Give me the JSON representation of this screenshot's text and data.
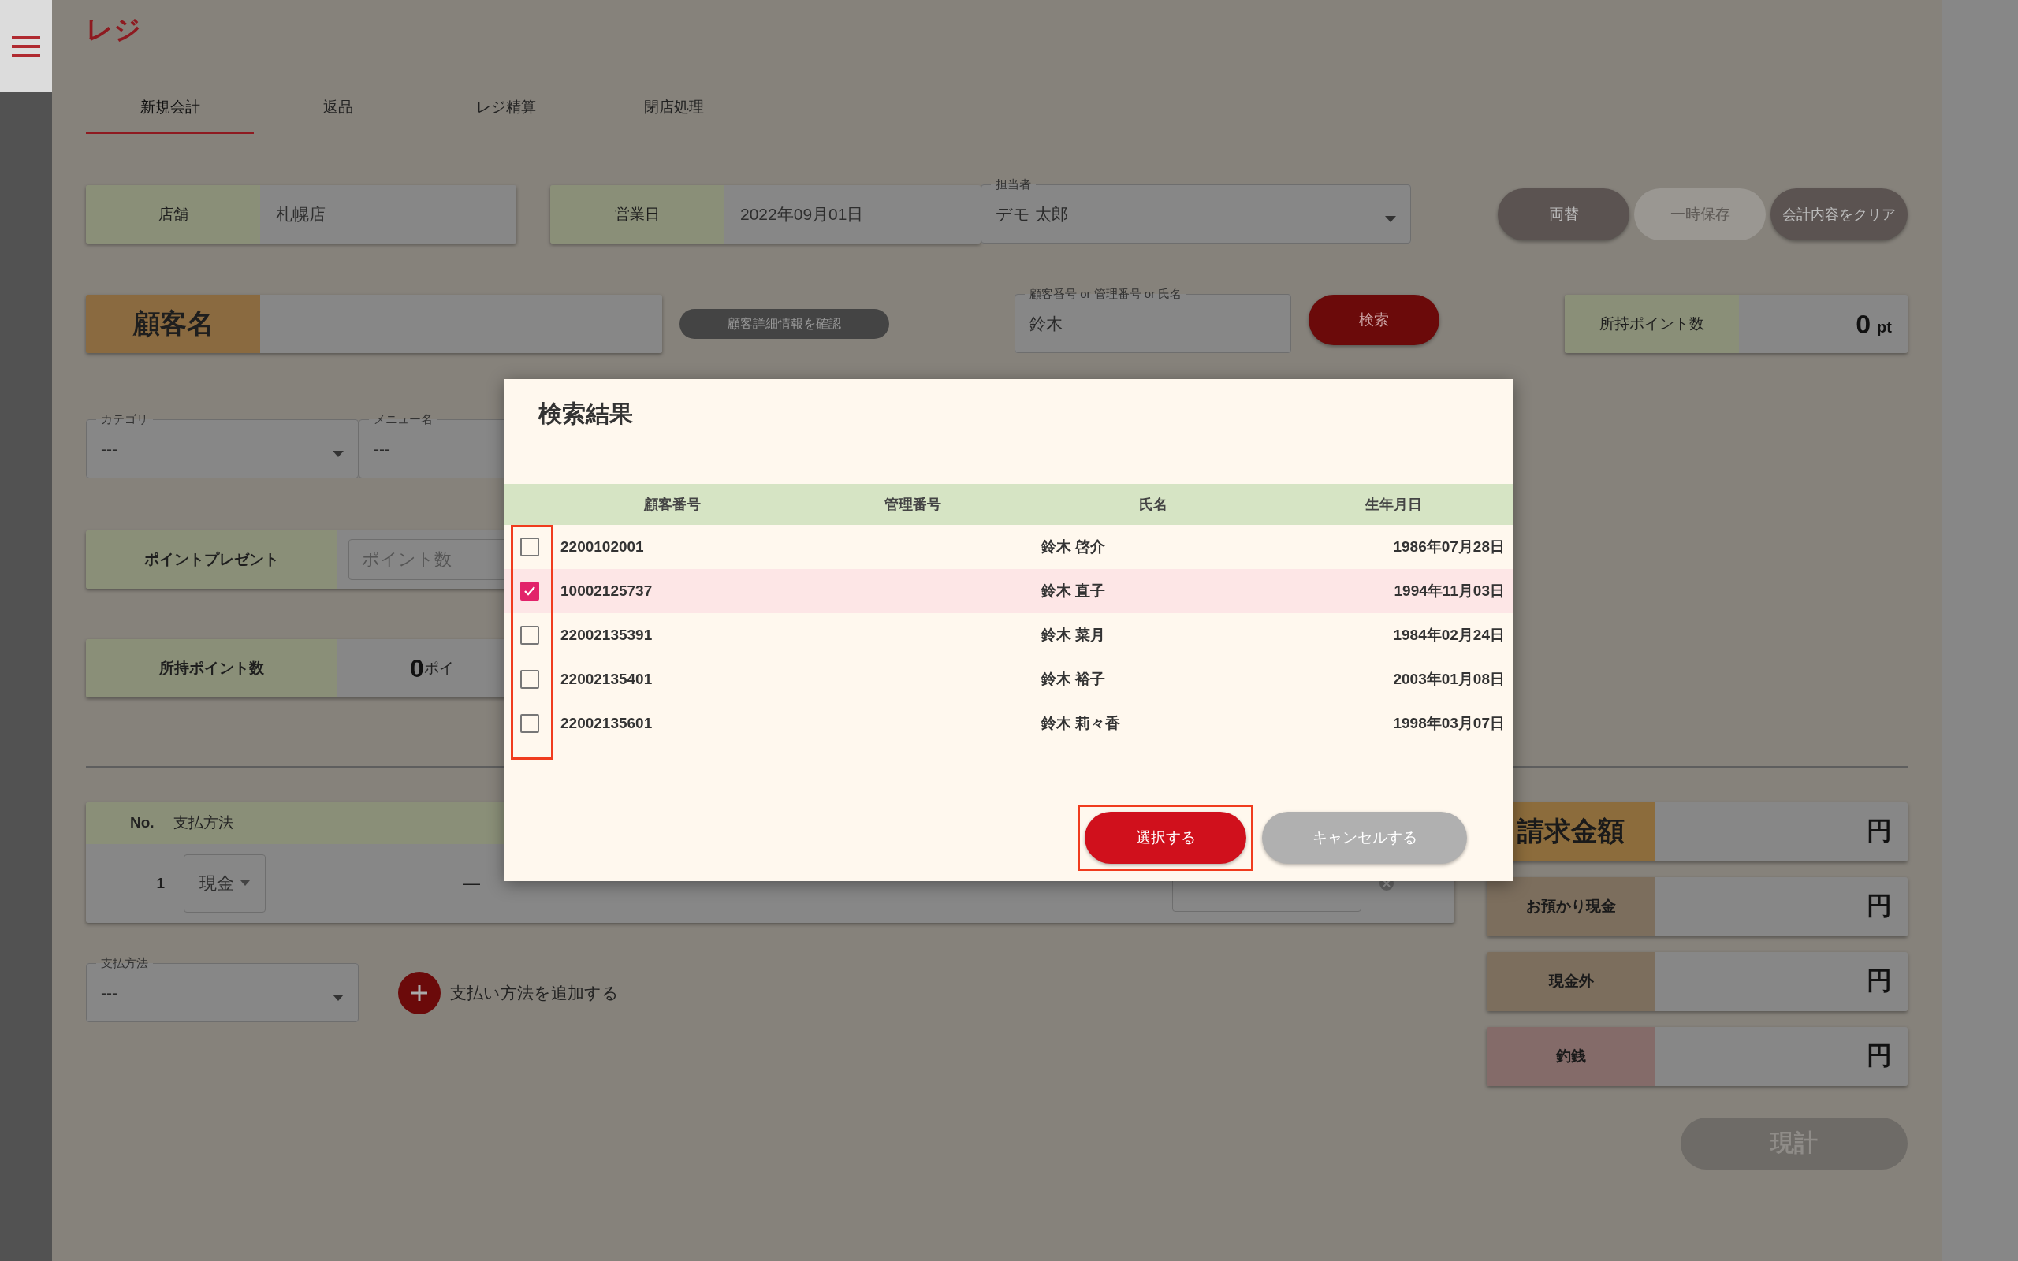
{
  "header": {
    "title": "レジ"
  },
  "tabs": [
    {
      "label": "新規会計",
      "selected": true
    },
    {
      "label": "返品",
      "selected": false
    },
    {
      "label": "レジ精算",
      "selected": false
    },
    {
      "label": "閉店処理",
      "selected": false
    }
  ],
  "store": {
    "label": "店舗",
    "value": "札幌店"
  },
  "business_day": {
    "label": "営業日",
    "value": "2022年09月01日"
  },
  "staff_select": {
    "label": "担当者",
    "value": "デモ 太郎"
  },
  "action_buttons": [
    {
      "label": "両替",
      "disabled": false
    },
    {
      "label": "一時保存",
      "disabled": true
    },
    {
      "label": "会計内容をクリア",
      "disabled": false
    }
  ],
  "customer": {
    "label": "顧客名",
    "detail_button": "顧客詳細情報を確認"
  },
  "search": {
    "label": "顧客番号 or 管理番号 or 氏名",
    "value": "鈴木",
    "button": "検索"
  },
  "points_card": {
    "label": "所持ポイント数",
    "value": "0",
    "unit": "pt"
  },
  "category_select": {
    "label": "カテゴリ",
    "value": "---"
  },
  "menu_select": {
    "label": "メニュー名",
    "value": "---"
  },
  "point_present": {
    "label": "ポイントプレゼント",
    "placeholder": "ポイント数"
  },
  "held_points": {
    "label": "所持ポイント数",
    "value": "0",
    "unit": "ポイ"
  },
  "payments": {
    "columns": [
      "No.",
      "支払方法"
    ],
    "rows": [
      {
        "no": "1",
        "method": "現金",
        "column_3": "—"
      }
    ]
  },
  "payment_method_select": {
    "label": "支払方法",
    "value": "---"
  },
  "add_payment": "支払い方法を追加する",
  "totals": [
    {
      "label": "請求金額",
      "unit": "円",
      "kind": "large",
      "color": "#8c6c3c"
    },
    {
      "label": "お預かり現金",
      "unit": "円",
      "kind": "regular",
      "color": "#7c6e5d"
    },
    {
      "label": "現金外",
      "unit": "円",
      "kind": "regular",
      "color": "#7c6e5d"
    },
    {
      "label": "釣銭",
      "unit": "円",
      "kind": "regular",
      "color": "#846b69"
    }
  ],
  "total_button": {
    "label": "現計",
    "disabled": true
  },
  "dialog": {
    "title": "検索結果",
    "checkbox_column_highlighted": true,
    "columns": [
      "顧客番号",
      "管理番号",
      "氏名",
      "生年月日"
    ],
    "rows": [
      {
        "checked": false,
        "customer_no": "2200102001",
        "name": "鈴木 啓介",
        "birthday": "1986年07月28日"
      },
      {
        "checked": true,
        "customer_no": "10002125737",
        "name": "鈴木 直子",
        "birthday": "1994年11月03日"
      },
      {
        "checked": false,
        "customer_no": "22002135391",
        "name": "鈴木 菜月",
        "birthday": "1984年02月24日"
      },
      {
        "checked": false,
        "customer_no": "22002135401",
        "name": "鈴木 裕子",
        "birthday": "2003年01月08日"
      },
      {
        "checked": false,
        "customer_no": "22002135601",
        "name": "鈴木 莉々香",
        "birthday": "1998年03月07日"
      }
    ],
    "buttons": [
      {
        "label": "選択する",
        "kind": "primary",
        "highlighted": true
      },
      {
        "label": "キャンセルする",
        "kind": "secondary",
        "highlighted": false
      }
    ]
  }
}
